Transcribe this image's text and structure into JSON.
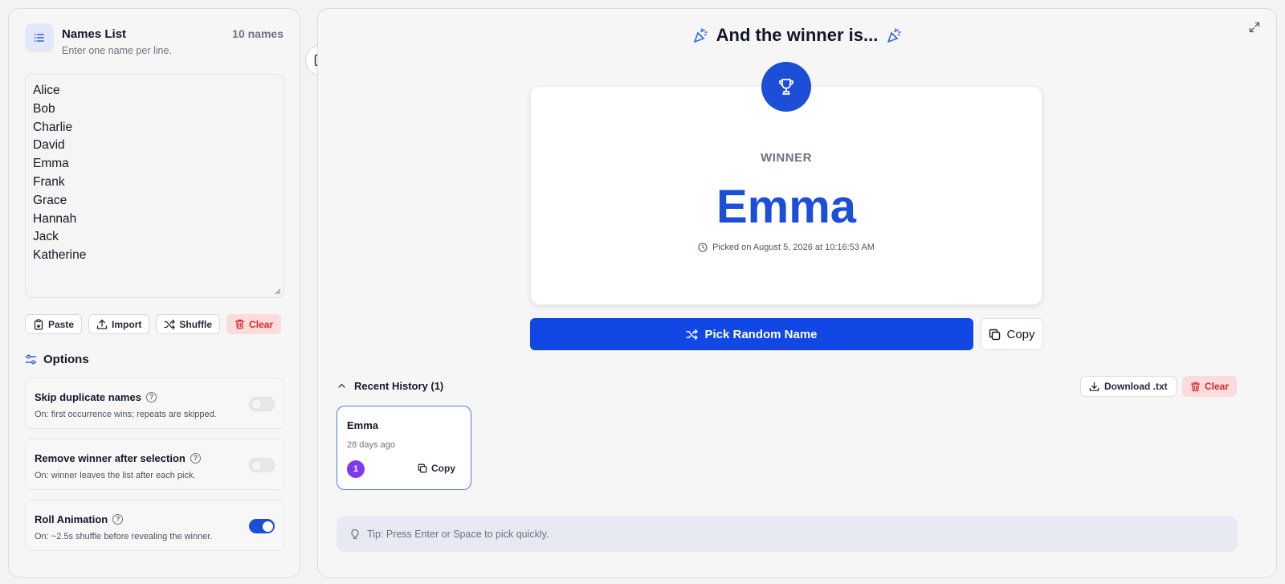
{
  "names_panel": {
    "title": "Names List",
    "subtitle": "Enter one name per line.",
    "count_label": "10 names",
    "names": [
      "Alice",
      "Bob",
      "Charlie",
      "David",
      "Emma",
      "Frank",
      "Grace",
      "Hannah",
      "Jack",
      "Katherine"
    ],
    "actions": {
      "paste": "Paste",
      "import": "Import",
      "shuffle": "Shuffle",
      "clear": "Clear"
    }
  },
  "options": {
    "heading": "Options",
    "items": [
      {
        "label": "Skip duplicate names",
        "description": "On: first occurrence wins; repeats are skipped.",
        "enabled": false
      },
      {
        "label": "Remove winner after selection",
        "description": "On: winner leaves the list after each pick.",
        "enabled": false
      },
      {
        "label": "Roll Animation",
        "description": "On: ~2.5s shuffle before revealing the winner.",
        "enabled": true
      }
    ]
  },
  "result": {
    "heading": "And the winner is...",
    "winner_label": "WINNER",
    "winner_name": "Emma",
    "picked_at": "Picked on August 5, 2026 at 10:16:53 AM",
    "pick_button": "Pick Random Name",
    "copy_button": "Copy"
  },
  "history": {
    "heading": "Recent History (1)",
    "download_button": "Download .txt",
    "clear_button": "Clear",
    "entries": [
      {
        "name": "Emma",
        "time": "28 days ago",
        "index": "1",
        "copy_label": "Copy"
      }
    ]
  },
  "tip": "Tip: Press Enter or Space to pick quickly.",
  "colors": {
    "accent": "#1d4ed8",
    "danger": "#dc2626",
    "badge_purple": "#7c3aed"
  },
  "icons": {
    "names_header": "list-icon",
    "collapse": "sidebar-collapse-icon",
    "expand": "expand-icon",
    "trophy": "trophy-icon",
    "party": "party-popper-icon"
  }
}
